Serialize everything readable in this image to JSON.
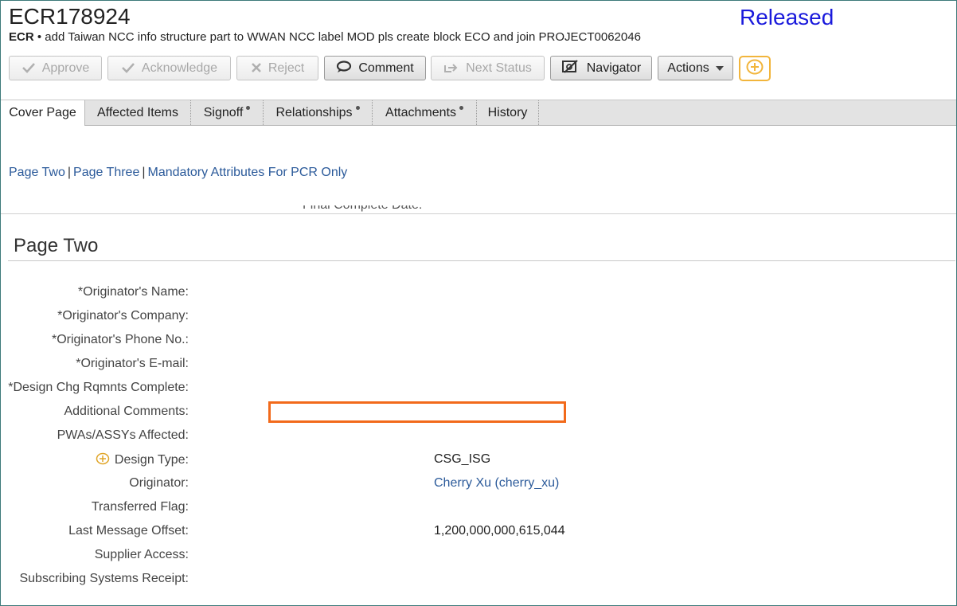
{
  "header": {
    "id": "ECR178924",
    "status": "Released",
    "type": "ECR",
    "separator": "•",
    "description": "add Taiwan NCC info structure part to WWAN NCC label MOD  pls create block ECO and join PROJECT0062046"
  },
  "toolbar": {
    "approve": "Approve",
    "acknowledge": "Acknowledge",
    "reject": "Reject",
    "comment": "Comment",
    "next_status": "Next Status",
    "navigator": "Navigator",
    "actions": "Actions"
  },
  "tabs": [
    {
      "label": "Cover Page"
    },
    {
      "label": "Affected Items"
    },
    {
      "label": "Signoff"
    },
    {
      "label": "Relationships"
    },
    {
      "label": "Attachments"
    },
    {
      "label": "History"
    }
  ],
  "links": {
    "page_two": "Page Two",
    "page_three": "Page Three",
    "mandatory": "Mandatory Attributes For PCR Only",
    "sep": "|"
  },
  "cutoff_label": "Final Complete Date:",
  "section": {
    "title": "Page Two",
    "fields": [
      {
        "label": "*Originator's Name:",
        "value": ""
      },
      {
        "label": "*Originator's Company:",
        "value": ""
      },
      {
        "label": "*Originator's Phone No.:",
        "value": ""
      },
      {
        "label": "*Originator's E-mail:",
        "value": ""
      },
      {
        "label": "*Design Chg Rqmnts Complete:",
        "value": ""
      },
      {
        "label": "Additional Comments:",
        "value": ""
      },
      {
        "label": "PWAs/ASSYs Affected:",
        "value": ""
      },
      {
        "label": "Design Type:",
        "value": "CSG_ISG"
      },
      {
        "label": "Originator:",
        "value": "Cherry Xu (cherry_xu)"
      },
      {
        "label": "Transferred Flag:",
        "value": ""
      },
      {
        "label": "Last Message Offset:",
        "value": "1,200,000,000,615,044"
      },
      {
        "label": "Supplier Access:",
        "value": ""
      },
      {
        "label": "Subscribing Systems Receipt:",
        "value": ""
      }
    ]
  },
  "colors": {
    "status": "#1a1adc",
    "link": "#2b5a9a",
    "highlight": "#f26a1b",
    "plus_accent": "#f2b53c"
  }
}
